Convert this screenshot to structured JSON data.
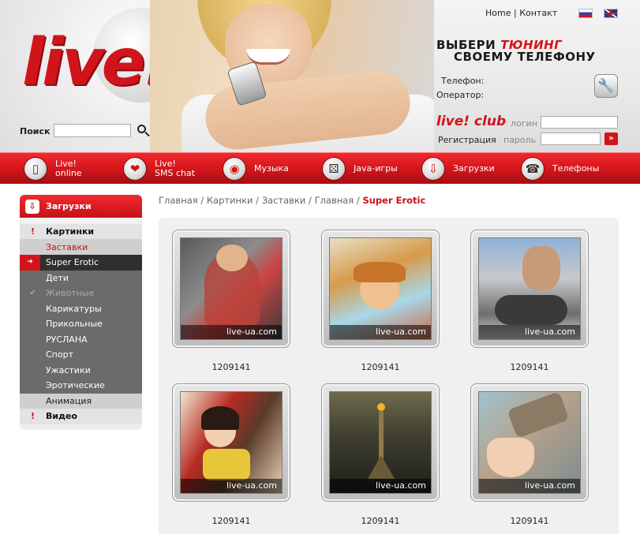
{
  "header": {
    "logo_text": "live!",
    "top_links": {
      "home": "Home",
      "separator": "|",
      "contact": "Контакт"
    },
    "slogan": {
      "part1": "ВЫБЕРИ",
      "part2": "ТЮНИНГ",
      "part3": "СВОЕМУ ТЕЛЕФОНУ"
    },
    "phone_label": "Телефон:",
    "operator_label": "Оператор:",
    "search": {
      "label": "Поиск",
      "placeholder": "",
      "value": ""
    },
    "club": {
      "logo": "live! club",
      "register": "Регистрация",
      "login_label": "логин",
      "password_label": "пароль",
      "go": "»"
    }
  },
  "nav": [
    {
      "label": "Live!\nonline",
      "icon": "phone-icon",
      "glyph": "📱"
    },
    {
      "label": "Live!\nSMS chat",
      "icon": "hearts-icon",
      "glyph": "❤"
    },
    {
      "label": "Музыка",
      "icon": "music-disc-icon",
      "glyph": "◉"
    },
    {
      "label": "Java-игры",
      "icon": "dice-icon",
      "glyph": "⚄"
    },
    {
      "label": "Загрузки",
      "icon": "download-icon",
      "glyph": "⇩"
    },
    {
      "label": "Телефоны",
      "icon": "phones-icon",
      "glyph": "☎"
    }
  ],
  "sidebar": {
    "title": "Загрузки",
    "cat_pictures": "Картинки",
    "sub_screensavers": "Заставки",
    "active": "Super Erotic",
    "items": [
      "Дети",
      "Животные",
      "Карикатуры",
      "Прикольные",
      "РУСЛАНА",
      "Спорт",
      "Ужастики",
      "Эротические"
    ],
    "animation": "Анимация",
    "video": "Видео"
  },
  "breadcrumb": {
    "items": [
      "Главная",
      "Картинки",
      "Заставки",
      "Главная"
    ],
    "separator": "/",
    "current": "Super Erotic"
  },
  "gallery": {
    "watermark": "live-ua.com",
    "items": [
      {
        "caption": "1209141"
      },
      {
        "caption": "1209141"
      },
      {
        "caption": "1209141"
      },
      {
        "caption": "1209141"
      },
      {
        "caption": "1209141"
      },
      {
        "caption": "1209141"
      }
    ]
  },
  "colors": {
    "brand_red": "#d1141b",
    "nav_red": "#e21c22",
    "sidebar_dark": "#6b6b6b",
    "sidebar_active": "#2f2f2f"
  }
}
